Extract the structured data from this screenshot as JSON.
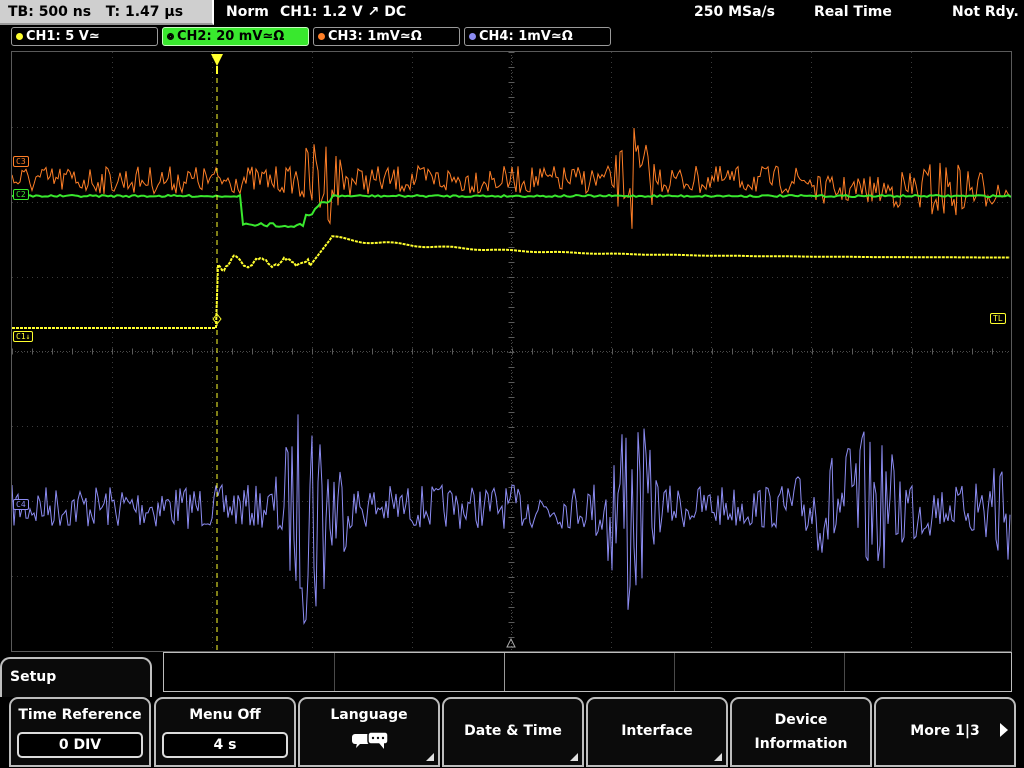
{
  "status": {
    "timebase": "TB: 500 ns",
    "trigger_time": "T: 1.47 µs",
    "mode": "Norm",
    "trigger_cfg": "CH1: 1.2 V ↗ DC",
    "sample_rate": "250 MSa/s",
    "acq_mode": "Real Time",
    "state": "Not Rdy."
  },
  "channels": [
    {
      "label": "CH1: 5 V≃",
      "color": "#ffff2e",
      "active": false
    },
    {
      "label": "CH2: 20 mV≃Ω",
      "color": "#39e82e",
      "active": true
    },
    {
      "label": "CH3: 1mV≃Ω",
      "color": "#ff7f27",
      "active": false
    },
    {
      "label": "CH4: 1mV≃Ω",
      "color": "#8c8cf2",
      "active": false
    }
  ],
  "markers": {
    "c1": "C1↓",
    "tl": "TL",
    "c2": "C2",
    "c3": "C3",
    "c4": "C4"
  },
  "bottom": {
    "setup_title": "Setup",
    "keys": {
      "time_reference": {
        "label": "Time Reference",
        "value": "0 DIV"
      },
      "menu_off": {
        "label": "Menu Off",
        "value": "4 s"
      },
      "language": {
        "label": "Language",
        "icon": "speech-bubbles-icon"
      },
      "date_time": {
        "label": "Date & Time"
      },
      "interface": {
        "label": "Interface"
      },
      "device_info": {
        "label1": "Device",
        "label2": "Information"
      },
      "more": {
        "label": "More 1|3"
      }
    }
  }
}
